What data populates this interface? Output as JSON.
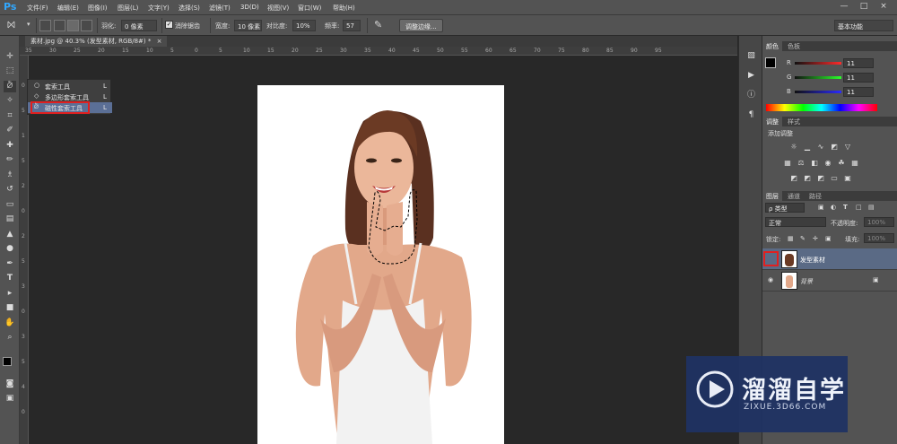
{
  "app": {
    "logo": "Ps"
  },
  "menu": [
    "文件(F)",
    "编辑(E)",
    "图像(I)",
    "图层(L)",
    "文字(Y)",
    "选择(S)",
    "滤镜(T)",
    "3D(D)",
    "视图(V)",
    "窗口(W)",
    "帮助(H)"
  ],
  "window_controls": [
    "—",
    "□",
    "×"
  ],
  "options": {
    "feather_label": "羽化:",
    "feather_value": "0 像素",
    "antialias_label": "消除锯齿",
    "width_label": "宽度:",
    "width_value": "10 像素",
    "contrast_label": "对比度:",
    "contrast_value": "10%",
    "frequency_label": "频率:",
    "frequency_value": "57",
    "refine_edge_button": "调整边缘...",
    "workspace": "基本功能"
  },
  "document": {
    "tab_title": "素材.jpg @ 40.3% (发型素材, RGB/8#) *",
    "close": "×"
  },
  "ruler": {
    "h_ticks": [
      "35",
      "30",
      "25",
      "20",
      "15",
      "10",
      "5",
      "0",
      "5",
      "10",
      "15",
      "20",
      "25",
      "30",
      "35",
      "40",
      "45",
      "50",
      "55",
      "60",
      "65",
      "70",
      "75",
      "80",
      "85",
      "90",
      "95"
    ],
    "v_ticks": [
      "0",
      "5",
      "1",
      "5",
      "2",
      "0",
      "2",
      "5",
      "3",
      "0",
      "3",
      "5",
      "4",
      "0"
    ]
  },
  "flyout": {
    "items": [
      {
        "label": "套索工具",
        "key": "L"
      },
      {
        "label": "多边形套索工具",
        "key": "L"
      },
      {
        "label": "磁性套索工具",
        "key": "L"
      }
    ],
    "selected_index": 2
  },
  "color_panel": {
    "tabs": [
      "颜色",
      "色板"
    ],
    "channels": [
      {
        "name": "R",
        "value": "11",
        "gradient_color": "#ff2a2a"
      },
      {
        "name": "G",
        "value": "11",
        "gradient_color": "#2aff2a"
      },
      {
        "name": "B",
        "value": "11",
        "gradient_color": "#2a2aff"
      }
    ]
  },
  "adjustments_panel": {
    "tabs": [
      "调整",
      "样式"
    ],
    "title": "添加调整"
  },
  "layers_panel": {
    "tabs": [
      "图层",
      "通道",
      "路径"
    ],
    "filter": "ρ 类型",
    "blend_mode": "正常",
    "opacity_label": "不透明度:",
    "opacity_value": "100%",
    "lock_label": "锁定:",
    "fill_label": "填充:",
    "fill_value": "100%",
    "layers": [
      {
        "name": "发型素材",
        "selected": true,
        "visible": false,
        "locked": false
      },
      {
        "name": "背景",
        "selected": false,
        "visible": true,
        "locked": true
      }
    ]
  },
  "watermark": {
    "brand": "溜溜自学",
    "url": "ZIXUE.3D66.COM"
  },
  "colors": {
    "accent": "#31a8ff",
    "selection_highlight": "#e02020",
    "layer_selected": "#5a6a85"
  }
}
